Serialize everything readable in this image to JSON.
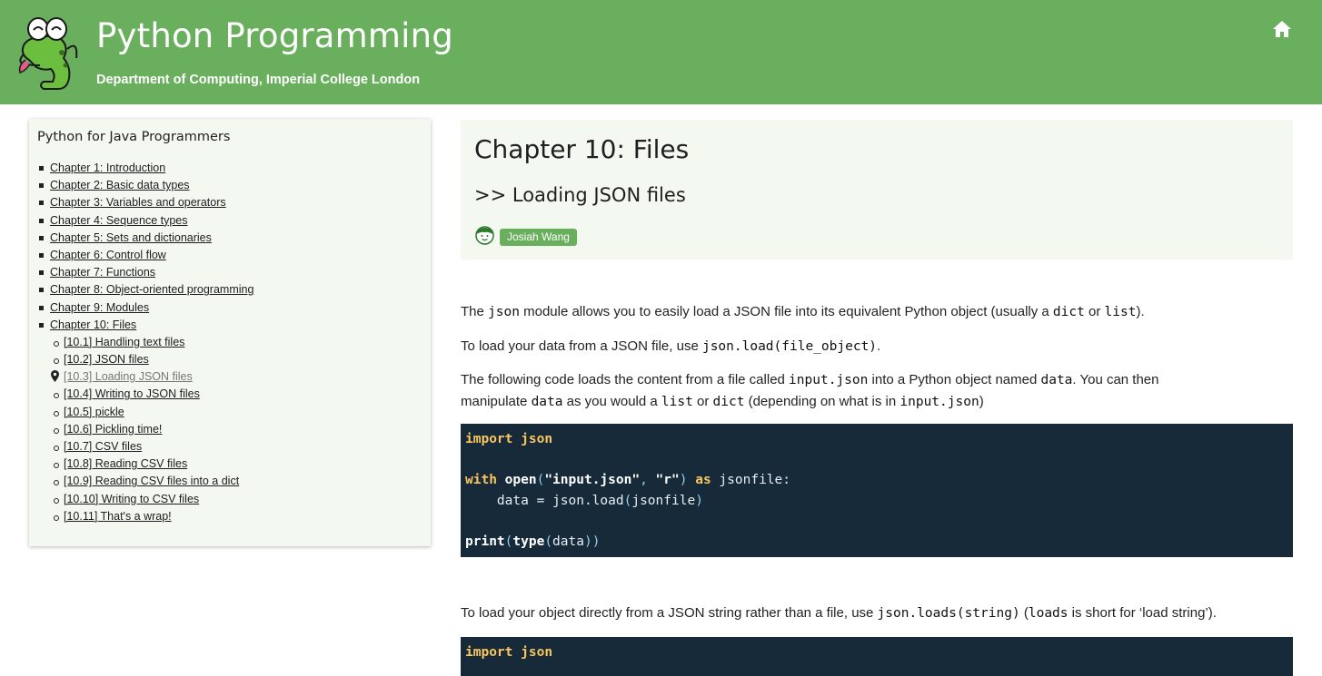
{
  "header": {
    "title": "Python Programming",
    "subtitle": "Department of Computing, Imperial College London",
    "brand_color": "#6aaf5e",
    "logo_icon": "frog-mascot-icon",
    "home_icon": "home-icon"
  },
  "sidebar": {
    "title": "Python for Java Programmers",
    "chapters": [
      "Chapter 1: Introduction",
      "Chapter 2: Basic data types",
      "Chapter 3: Variables and operators",
      "Chapter 4: Sequence types",
      "Chapter 5: Sets and dictionaries",
      "Chapter 6: Control flow",
      "Chapter 7: Functions",
      "Chapter 8: Object-oriented programming",
      "Chapter 9: Modules",
      "Chapter 10: Files"
    ],
    "sections": [
      "[10.1] Handling text files",
      "[10.2] JSON files",
      "[10.3] Loading JSON files",
      "[10.4] Writing to JSON files",
      "[10.5] pickle",
      "[10.6] Pickling time!",
      "[10.7] CSV files",
      "[10.8] Reading CSV files",
      "[10.9] Reading CSV files into a dict",
      "[10.10] Writing to CSV files",
      "[10.11] That's a wrap!"
    ],
    "active_section": "[10.3] Loading JSON files"
  },
  "content": {
    "chapter_title": "Chapter 10: Files",
    "section_title": ">> Loading JSON files",
    "author": "Josiah Wang",
    "p1": {
      "t1": "The ",
      "c1": "json",
      "t2": " module allows you to easily load a JSON file into its equivalent Python object (usually a ",
      "c2": "dict",
      "t3": " or ",
      "c3": "list",
      "t4": ")."
    },
    "p2": {
      "t1": "To load your data from a JSON file, use ",
      "c1": "json.load(file_object)",
      "t2": "."
    },
    "p3": {
      "t1": "The following code loads the content from a file called ",
      "c1": "input.json",
      "t2": " into a Python object named ",
      "c2": "data",
      "t3": ". You can then",
      "t4": "manipulate ",
      "c3": "data",
      "t5": " as you would a ",
      "c4": "list",
      "t6": " or ",
      "c5": "dict",
      "t7": " (depending on what is in ",
      "c6": "input.json",
      "t8": ")"
    },
    "code1": {
      "l1": {
        "kw1": "import",
        "sp": " ",
        "mod": "json"
      },
      "l2": {
        "kw1": "with",
        "sp1": " ",
        "fn": "open",
        "p1": "(",
        "s1": "\"input.json\"",
        "cm": ", ",
        "s2": "\"r\"",
        "p2": ")",
        "sp2": " ",
        "kw2": "as",
        "rest": " jsonfile:"
      },
      "l3": {
        "indent": "    ",
        "a": "data = json.load",
        "p1": "(",
        "b": "jsonfile",
        "p2": ")"
      },
      "l4": {
        "fn1": "print",
        "p1": "(",
        "fn2": "type",
        "p2": "(",
        "a": "data",
        "p3": "))"
      }
    },
    "p4": {
      "t1": "To load your object directly from a JSON string rather than a file, use ",
      "c1": "json.loads(string)",
      "t2": " (",
      "c2": "loads",
      "t3": " is short for ‘load string’)."
    },
    "code2": {
      "l1": {
        "kw1": "import",
        "sp": " ",
        "mod": "json"
      }
    },
    "code_bg": "#172a3a",
    "keyword_color": "#fac65d"
  }
}
